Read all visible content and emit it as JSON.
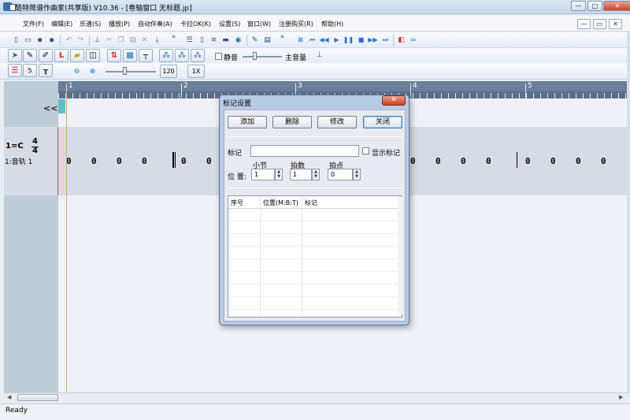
{
  "window": {
    "title": "酷特简谱作曲家(共享版) V10.36 - [卷轴窗口 无标题.jp]",
    "controls": [
      "—",
      "□",
      "✕"
    ]
  },
  "menu": {
    "items": [
      "文件(F)",
      "编辑(E)",
      "乐谱(S)",
      "播放(P)",
      "自动伴奏(A)",
      "卡拉OK(K)",
      "设置(S)",
      "窗口(W)",
      "注册购买(R)",
      "帮助(H)"
    ],
    "mdi_controls": [
      "—",
      "▭",
      "✕"
    ]
  },
  "toolbar": {
    "overflow": "»",
    "mute_label": "静音",
    "volume_label": "主音量",
    "step_value": "5",
    "tempo_value": "120",
    "speed_value": "1X"
  },
  "ruler": {
    "bars": [
      "1",
      "2",
      "3",
      "4",
      "5"
    ]
  },
  "score": {
    "collapse_label": "<<",
    "key": "1=C",
    "time_sig_top": "4",
    "time_sig_bottom": "4",
    "track_label": "1:音轨  1",
    "notes": [
      "0",
      "0",
      "0",
      "0",
      "0",
      "0",
      "0",
      "0",
      "0",
      "0",
      "0",
      "0",
      "0",
      "0"
    ]
  },
  "status": {
    "text": "Ready"
  },
  "dialog": {
    "title": "标记设置",
    "close_label": "✕",
    "buttons": {
      "add": "添加",
      "delete": "删除",
      "modify": "修改",
      "close": "关闭"
    },
    "mark_label": "标记",
    "mark_value": "",
    "show_mark_label": "显示标记",
    "position_label": "位  置:",
    "bar_label": "小节",
    "beat_label": "拍数",
    "tick_label": "拍点",
    "bar_value": "1",
    "beat_value": "1",
    "tick_value": "0",
    "list_headers": [
      "序号",
      "位置(M:B:T)",
      "标记"
    ]
  }
}
